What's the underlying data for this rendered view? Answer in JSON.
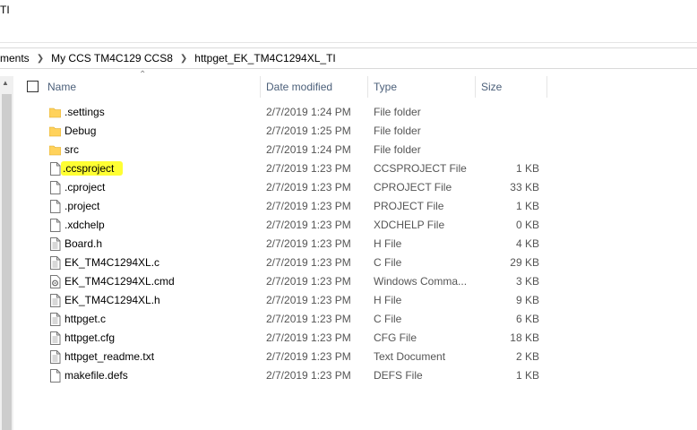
{
  "window": {
    "title_fragment": "TI"
  },
  "breadcrumb": [
    "ments",
    "My CCS TM4C129 CCS8",
    "httpget_EK_TM4C1294XL_TI"
  ],
  "columns": {
    "name": "Name",
    "date": "Date modified",
    "type": "Type",
    "size": "Size"
  },
  "files": [
    {
      "name": ".settings",
      "date": "2/7/2019 1:24 PM",
      "type": "File folder",
      "size": "",
      "icon": "folder-icon"
    },
    {
      "name": "Debug",
      "date": "2/7/2019 1:25 PM",
      "type": "File folder",
      "size": "",
      "icon": "folder-icon"
    },
    {
      "name": "src",
      "date": "2/7/2019 1:24 PM",
      "type": "File folder",
      "size": "",
      "icon": "folder-icon"
    },
    {
      "name": ".ccsproject",
      "date": "2/7/2019 1:23 PM",
      "type": "CCSPROJECT File",
      "size": "1 KB",
      "icon": "file-icon",
      "highlighted": true
    },
    {
      "name": ".cproject",
      "date": "2/7/2019 1:23 PM",
      "type": "CPROJECT File",
      "size": "33 KB",
      "icon": "file-icon"
    },
    {
      "name": ".project",
      "date": "2/7/2019 1:23 PM",
      "type": "PROJECT File",
      "size": "1 KB",
      "icon": "file-icon"
    },
    {
      "name": ".xdchelp",
      "date": "2/7/2019 1:23 PM",
      "type": "XDCHELP File",
      "size": "0 KB",
      "icon": "file-icon"
    },
    {
      "name": "Board.h",
      "date": "2/7/2019 1:23 PM",
      "type": "H File",
      "size": "4 KB",
      "icon": "text-file-icon"
    },
    {
      "name": "EK_TM4C1294XL.c",
      "date": "2/7/2019 1:23 PM",
      "type": "C File",
      "size": "29 KB",
      "icon": "text-file-icon"
    },
    {
      "name": "EK_TM4C1294XL.cmd",
      "date": "2/7/2019 1:23 PM",
      "type": "Windows Comma...",
      "size": "3 KB",
      "icon": "cmd-file-icon"
    },
    {
      "name": "EK_TM4C1294XL.h",
      "date": "2/7/2019 1:23 PM",
      "type": "H File",
      "size": "9 KB",
      "icon": "text-file-icon"
    },
    {
      "name": "httpget.c",
      "date": "2/7/2019 1:23 PM",
      "type": "C File",
      "size": "6 KB",
      "icon": "text-file-icon"
    },
    {
      "name": "httpget.cfg",
      "date": "2/7/2019 1:23 PM",
      "type": "CFG File",
      "size": "18 KB",
      "icon": "text-file-icon"
    },
    {
      "name": "httpget_readme.txt",
      "date": "2/7/2019 1:23 PM",
      "type": "Text Document",
      "size": "2 KB",
      "icon": "text-file-icon"
    },
    {
      "name": "makefile.defs",
      "date": "2/7/2019 1:23 PM",
      "type": "DEFS File",
      "size": "1 KB",
      "icon": "file-icon"
    }
  ],
  "colors": {
    "folder": "#ffd25c",
    "highlight": "#ffff33",
    "header_text": "#4c607a"
  }
}
